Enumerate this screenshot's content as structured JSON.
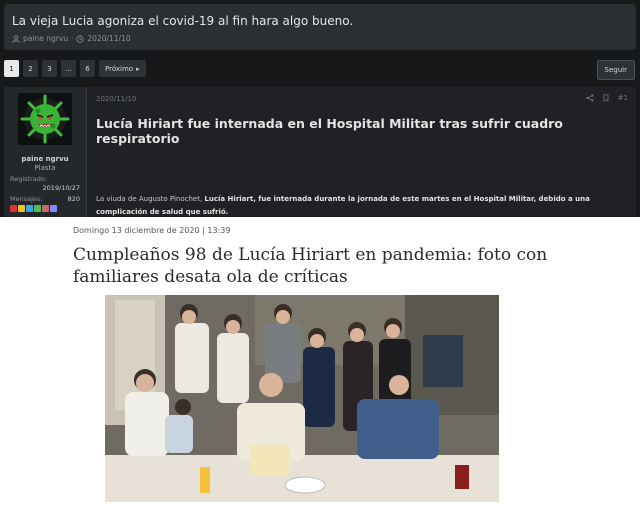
{
  "thread": {
    "title": "La vieja Lucia agoniza el covid-19 al fin hara algo bueno.",
    "author": "paine ngrvu",
    "date": "2020/11/10"
  },
  "pagination": {
    "pages": [
      "1",
      "2",
      "3",
      "...",
      "6"
    ],
    "current": "1",
    "next_label": "Próximo",
    "follow_label": "Seguir"
  },
  "post": {
    "user": {
      "name": "paine ngrvu",
      "title": "Plasta",
      "registered_label": "Registrado:",
      "registered_value": "2019/10/27",
      "messages_label": "Mensajes:",
      "messages_value": "820"
    },
    "date": "2020/11/10",
    "number": "#1",
    "heading": "Lucía Hiriart fue internada en el Hospital Militar tras sufrir cuadro respiratorio",
    "body_prefix": "La viuda de Augusto Pinochet, ",
    "body_bold": "Lucía Hiriart, fue internada durante la jornada de este martes en el Hospital Militar, debido a una complicación de salud que sufrió."
  },
  "article": {
    "date": "Domingo 13 diciembre de 2020 | 13:39",
    "title": "Cumpleaños 98 de Lucía Hiriart en pandemia: foto con familiares desata ola de críticas"
  },
  "colors": {
    "forum_bg": "#17181a",
    "panel_bg": "#2b2e32",
    "accent_green": "#1f7a2a"
  },
  "icons": {
    "author": "user-icon",
    "date": "clock-icon",
    "share": "share-icon",
    "bookmark": "bookmark-icon",
    "next": "caret-right-icon"
  }
}
